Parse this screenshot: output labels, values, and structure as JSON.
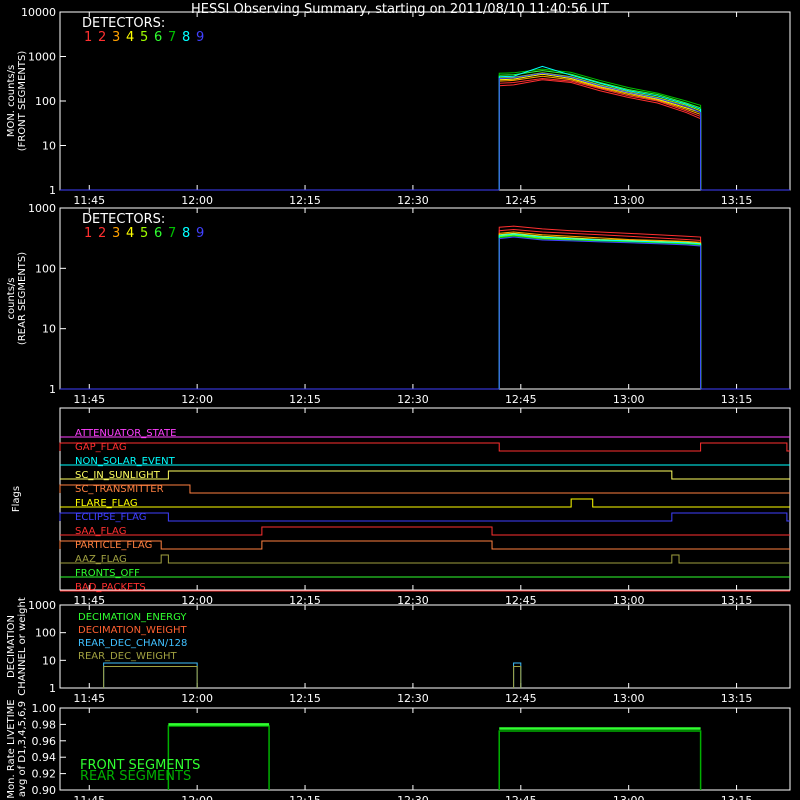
{
  "chart_data": {
    "title": "HESSI Observing Summary, starting on 2011/08/10 11:40:56 UT",
    "time_ticks": [
      "11:45",
      "12:00",
      "12:15",
      "12:30",
      "12:45",
      "13:00",
      "13:15"
    ],
    "panels": [
      {
        "id": "front",
        "type": "line",
        "ylabel": [
          "MON. counts/s",
          "(FRONT SEGMENTS)"
        ],
        "ytick_labels": [
          "1",
          "10",
          "100",
          "1000",
          "10000"
        ],
        "legend_title": "DETECTORS:",
        "legend_numbers": [
          "1",
          "2",
          "3",
          "4",
          "5",
          "6",
          "7",
          "8",
          "9"
        ],
        "colors": [
          "#ff3030",
          "#ff3030",
          "#ffa000",
          "#ffff00",
          "#a0ff00",
          "#30ff30",
          "#00c000",
          "#00ffff",
          "#4040ff"
        ],
        "description_series": "approximate envelope values per detector (counts/s)",
        "x": [
          "12:42",
          "12:44",
          "12:48",
          "12:52",
          "12:56",
          "13:00",
          "13:04",
          "13:08",
          "13:10"
        ],
        "series": [
          {
            "values": [
              220,
              230,
              300,
              260,
              170,
              120,
              90,
              55,
              40
            ]
          },
          {
            "values": [
              250,
              260,
              320,
              280,
              190,
              130,
              100,
              60,
              45
            ]
          },
          {
            "values": [
              280,
              290,
              360,
              300,
              200,
              140,
              105,
              65,
              50
            ]
          },
          {
            "values": [
              300,
              310,
              400,
              320,
              210,
              150,
              110,
              70,
              55
            ]
          },
          {
            "values": [
              330,
              340,
              430,
              350,
              230,
              160,
              120,
              80,
              60
            ]
          },
          {
            "values": [
              380,
              390,
              480,
              400,
              260,
              180,
              140,
              90,
              70
            ]
          },
          {
            "values": [
              420,
              430,
              520,
              440,
              290,
              200,
              150,
              100,
              80
            ]
          },
          {
            "values": [
              350,
              360,
              600,
              380,
              250,
              170,
              130,
              85,
              65
            ]
          },
          {
            "values": [
              320,
              330,
              420,
              340,
              220,
              155,
              115,
              75,
              55
            ]
          }
        ]
      },
      {
        "id": "rear",
        "type": "line",
        "ylabel": [
          "counts/s",
          "(REAR SEGMENTS)"
        ],
        "ytick_labels": [
          "1",
          "10",
          "100",
          "1000"
        ],
        "legend_title": "DETECTORS:",
        "legend_numbers": [
          "1",
          "2",
          "3",
          "4",
          "5",
          "6",
          "7",
          "8",
          "9"
        ],
        "colors": [
          "#ff3030",
          "#ff3030",
          "#ffa000",
          "#ffff00",
          "#a0ff00",
          "#30ff30",
          "#00c000",
          "#00ffff",
          "#4040ff"
        ],
        "x": [
          "12:42",
          "12:44",
          "12:48",
          "12:52",
          "12:56",
          "13:00",
          "13:04",
          "13:08",
          "13:10"
        ],
        "series": [
          {
            "values": [
              480,
              500,
              450,
              420,
              400,
              380,
              360,
              340,
              330
            ]
          },
          {
            "values": [
              420,
              440,
              400,
              380,
              360,
              340,
              320,
              300,
              290
            ]
          },
          {
            "values": [
              380,
              400,
              360,
              340,
              320,
              300,
              290,
              280,
              270
            ]
          },
          {
            "values": [
              360,
              380,
              340,
              320,
              300,
              290,
              280,
              270,
              260
            ]
          },
          {
            "values": [
              340,
              360,
              320,
              300,
              290,
              280,
              270,
              260,
              250
            ]
          },
          {
            "values": [
              330,
              350,
              310,
              295,
              285,
              275,
              265,
              255,
              245
            ]
          },
          {
            "values": [
              320,
              340,
              300,
              290,
              280,
              270,
              260,
              250,
              240
            ]
          },
          {
            "values": [
              350,
              370,
              330,
              310,
              295,
              285,
              275,
              265,
              255
            ]
          },
          {
            "values": [
              310,
              330,
              295,
              285,
              275,
              265,
              255,
              245,
              235
            ]
          }
        ]
      },
      {
        "id": "flags",
        "ylabel": [
          "Flags"
        ],
        "flags": [
          {
            "name": "ATTENUATOR_STATE",
            "color": "#ff40ff",
            "high": []
          },
          {
            "name": "GAP_FLAG",
            "color": "#ff3030",
            "high": [
              [
                "11:40",
                "12:42"
              ],
              [
                "13:10",
                "13:22"
              ]
            ]
          },
          {
            "name": "NON_SOLAR_EVENT",
            "color": "#00ffff",
            "high": []
          },
          {
            "name": "SC_IN_SUNLIGHT",
            "color": "#ffff60",
            "high": [
              [
                "11:56",
                "13:06"
              ]
            ]
          },
          {
            "name": "SC_TRANSMITTER",
            "color": "#ff8040",
            "high": [
              [
                "11:40",
                "11:59"
              ]
            ]
          },
          {
            "name": "FLARE_FLAG",
            "color": "#ffff00",
            "high": [
              [
                "12:52",
                "12:55"
              ]
            ]
          },
          {
            "name": "ECLIPSE_FLAG",
            "color": "#4040ff",
            "high": [
              [
                "11:40",
                "11:56"
              ],
              [
                "13:06",
                "13:22"
              ]
            ]
          },
          {
            "name": "SAA_FLAG",
            "color": "#ff3030",
            "high": [
              [
                "12:09",
                "12:41"
              ]
            ]
          },
          {
            "name": "PARTICLE_FLAG",
            "color": "#ff8040",
            "high": [
              [
                "11:40",
                "11:55"
              ],
              [
                "12:09",
                "12:41"
              ]
            ]
          },
          {
            "name": "AAZ_FLAG",
            "color": "#a0a040",
            "high": [
              [
                "11:55",
                "11:56"
              ],
              [
                "13:06",
                "13:07"
              ]
            ]
          },
          {
            "name": "FRONTS_OFF",
            "color": "#30ff30",
            "high": []
          },
          {
            "name": "BAD_PACKETS",
            "color": "#ff3030",
            "high": []
          }
        ]
      },
      {
        "id": "decimation",
        "type": "line",
        "ylabel": [
          "DECIMATION",
          "CHANNEL or weight"
        ],
        "ytick_labels": [
          "1",
          "10",
          "100",
          "1000"
        ],
        "legend": [
          {
            "name": "DECIMATION_ENERGY",
            "color": "#30ff30"
          },
          {
            "name": "DECIMATION_WEIGHT",
            "color": "#ff6030"
          },
          {
            "name": "REAR_DEC_CHAN/128",
            "color": "#40c0ff"
          },
          {
            "name": "REAR_DEC_WEIGHT",
            "color": "#a0a040"
          }
        ],
        "segments": [
          {
            "series": "REAR_DEC_CHAN/128",
            "start": "11:47",
            "end": "12:00",
            "value": 8
          },
          {
            "series": "REAR_DEC_WEIGHT",
            "start": "11:47",
            "end": "12:00",
            "value": 6
          },
          {
            "series": "REAR_DEC_CHAN/128",
            "start": "12:44",
            "end": "12:45",
            "value": 8
          },
          {
            "series": "REAR_DEC_WEIGHT",
            "start": "12:44",
            "end": "12:45",
            "value": 6
          }
        ]
      },
      {
        "id": "livetime",
        "type": "line",
        "ylabel": [
          "Mon. Rate LIVETIME",
          "avg of D1,3,4,5,6,9"
        ],
        "ytick_labels": [
          "0.90",
          "0.92",
          "0.94",
          "0.96",
          "0.98",
          "1.00"
        ],
        "ylim": [
          0.9,
          1.0
        ],
        "legend": [
          {
            "name": "FRONT SEGMENTS",
            "color": "#30ff30"
          },
          {
            "name": "REAR SEGMENTS",
            "color": "#00b000"
          }
        ],
        "segments": [
          {
            "start": "11:56",
            "end": "12:10",
            "front": 0.98,
            "rear": 0.978
          },
          {
            "start": "12:42",
            "end": "13:10",
            "front": 0.975,
            "rear": 0.972
          }
        ]
      }
    ]
  }
}
